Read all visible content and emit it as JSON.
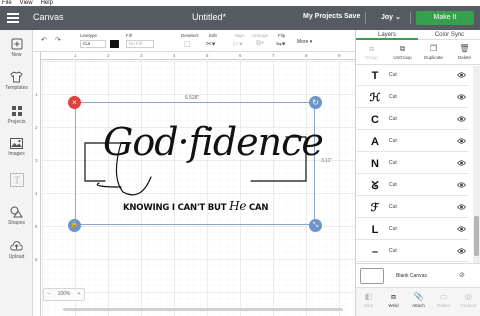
{
  "os_menu": [
    "File",
    "View",
    "Help"
  ],
  "header": {
    "app_name": "Canvas",
    "doc_title": "Untitled*",
    "my_projects": "My Projects",
    "save": "Save",
    "user": "Joy",
    "user_chevron": "⌄",
    "make_it": "Make It",
    "make_it_color": "#36a04f"
  },
  "sidebar": {
    "items": [
      {
        "label": "New",
        "icon": "plus-icon"
      },
      {
        "label": "Templates",
        "icon": "shirt-icon"
      },
      {
        "label": "Projects",
        "icon": "grid-icon"
      },
      {
        "label": "Images",
        "icon": "image-icon"
      },
      {
        "label": "Shapes",
        "icon": "shapes-icon"
      },
      {
        "label": "Upload",
        "icon": "upload-icon"
      }
    ]
  },
  "toolbar": {
    "linetype_label": "Linetype",
    "linetype_value": "Cut",
    "fill_label": "Fill",
    "fill_value": "No Fill",
    "deselect_label": "Deselect",
    "edit_label": "Edit",
    "align_label": "Align",
    "arrange_label": "Arrange",
    "flip_label": "Flip",
    "more_label": "More",
    "more_chevron": "▾"
  },
  "canvas": {
    "ruler_top": [
      "1",
      "2",
      "3",
      "4",
      "5",
      "6",
      "7",
      "8",
      "9"
    ],
    "ruler_left": [
      "1",
      "2",
      "3",
      "4",
      "5",
      "6"
    ],
    "width_dim": "6.528\"",
    "height_dim": "3.11\"",
    "design_script_text": "God·fidence",
    "design_caps_text": "KNOWING I CAN'T BUT",
    "design_he": "He",
    "design_can": "CAN",
    "zoom_minus": "−",
    "zoom_value": "100%",
    "zoom_plus": "+"
  },
  "right_panel": {
    "tabs": [
      "Layers",
      "Color Sync"
    ],
    "actions": [
      {
        "label": "Group",
        "icon": "group-icon",
        "enabled": false
      },
      {
        "label": "UnGroup",
        "icon": "ungroup-icon",
        "enabled": true
      },
      {
        "label": "Duplicate",
        "icon": "duplicate-icon",
        "enabled": true
      },
      {
        "label": "Delete",
        "icon": "trash-icon",
        "enabled": true
      }
    ],
    "layers": [
      {
        "glyph": "T",
        "name": "Cut"
      },
      {
        "glyph": "ℋ",
        "name": "Cut"
      },
      {
        "glyph": "C",
        "name": "Cut"
      },
      {
        "glyph": "A",
        "name": "Cut"
      },
      {
        "glyph": "N",
        "name": "Cut"
      },
      {
        "glyph": "ᘜ",
        "name": "Cut"
      },
      {
        "glyph": "ℱ",
        "name": "Cut"
      },
      {
        "glyph": "L",
        "name": "Cut"
      },
      {
        "glyph": "–",
        "name": "Cut"
      },
      {
        "glyph": "—",
        "name": "Cut"
      }
    ],
    "blank_canvas": "Blank Canvas",
    "bottom_actions": [
      {
        "label": "Slice",
        "icon": "slice-icon",
        "enabled": false
      },
      {
        "label": "Weld",
        "icon": "weld-icon",
        "enabled": true
      },
      {
        "label": "Attach",
        "icon": "attach-icon",
        "enabled": true
      },
      {
        "label": "Flatten",
        "icon": "flatten-icon",
        "enabled": false
      },
      {
        "label": "Contour",
        "icon": "contour-icon",
        "enabled": false
      }
    ]
  }
}
